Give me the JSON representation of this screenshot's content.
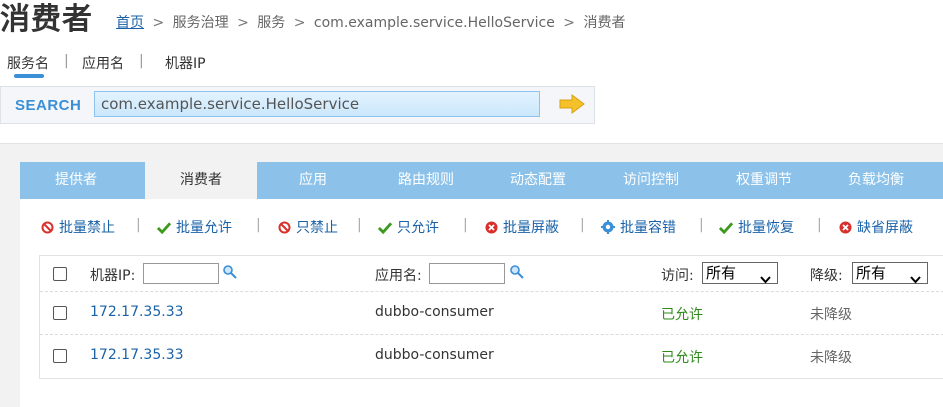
{
  "header": {
    "title": "消费者",
    "breadcrumb": {
      "home": "首页",
      "sep": ">",
      "items": [
        "服务治理",
        "服务",
        "com.example.service.HelloService",
        "消费者"
      ]
    }
  },
  "search": {
    "tabs": [
      {
        "label": "服务名",
        "active": true
      },
      {
        "label": "应用名",
        "active": false
      },
      {
        "label": "机器IP",
        "active": false
      }
    ],
    "divider": "|",
    "label": "SEARCH",
    "value": "com.example.service.HelloService",
    "go_icon": "arrow-right-icon"
  },
  "tabs": [
    "提供者",
    "消费者",
    "应用",
    "路由规则",
    "动态配置",
    "访问控制",
    "权重调节",
    "负载均衡"
  ],
  "active_tab": "消费者",
  "actions": [
    {
      "label": "批量禁止",
      "icon": "forbid-icon"
    },
    {
      "label": "批量允许",
      "icon": "check-icon"
    },
    {
      "label": "只禁止",
      "icon": "forbid-icon"
    },
    {
      "label": "只允许",
      "icon": "check-icon"
    },
    {
      "label": "批量屏蔽",
      "icon": "block-icon"
    },
    {
      "label": "批量容错",
      "icon": "gear-icon"
    },
    {
      "label": "批量恢复",
      "icon": "check-icon"
    },
    {
      "label": "缺省屏蔽",
      "icon": "block-icon"
    }
  ],
  "action_separator": "|",
  "table": {
    "filters": {
      "ip_label": "机器IP:",
      "app_label": "应用名:",
      "access_label": "访问:",
      "access_value": "所有",
      "degrade_label": "降级:",
      "degrade_value": "所有"
    },
    "rows": [
      {
        "ip": "172.17.35.33",
        "app": "dubbo-consumer",
        "access": "已允许",
        "degrade": "未降级"
      },
      {
        "ip": "172.17.35.33",
        "app": "dubbo-consumer",
        "access": "已允许",
        "degrade": "未降级"
      }
    ]
  },
  "colors": {
    "tab_bar": "#8cc2ea",
    "link": "#1a62a8",
    "allowed": "#2e8b1a",
    "search_label": "#3a8fd6",
    "arrow": "#f5c12b"
  }
}
